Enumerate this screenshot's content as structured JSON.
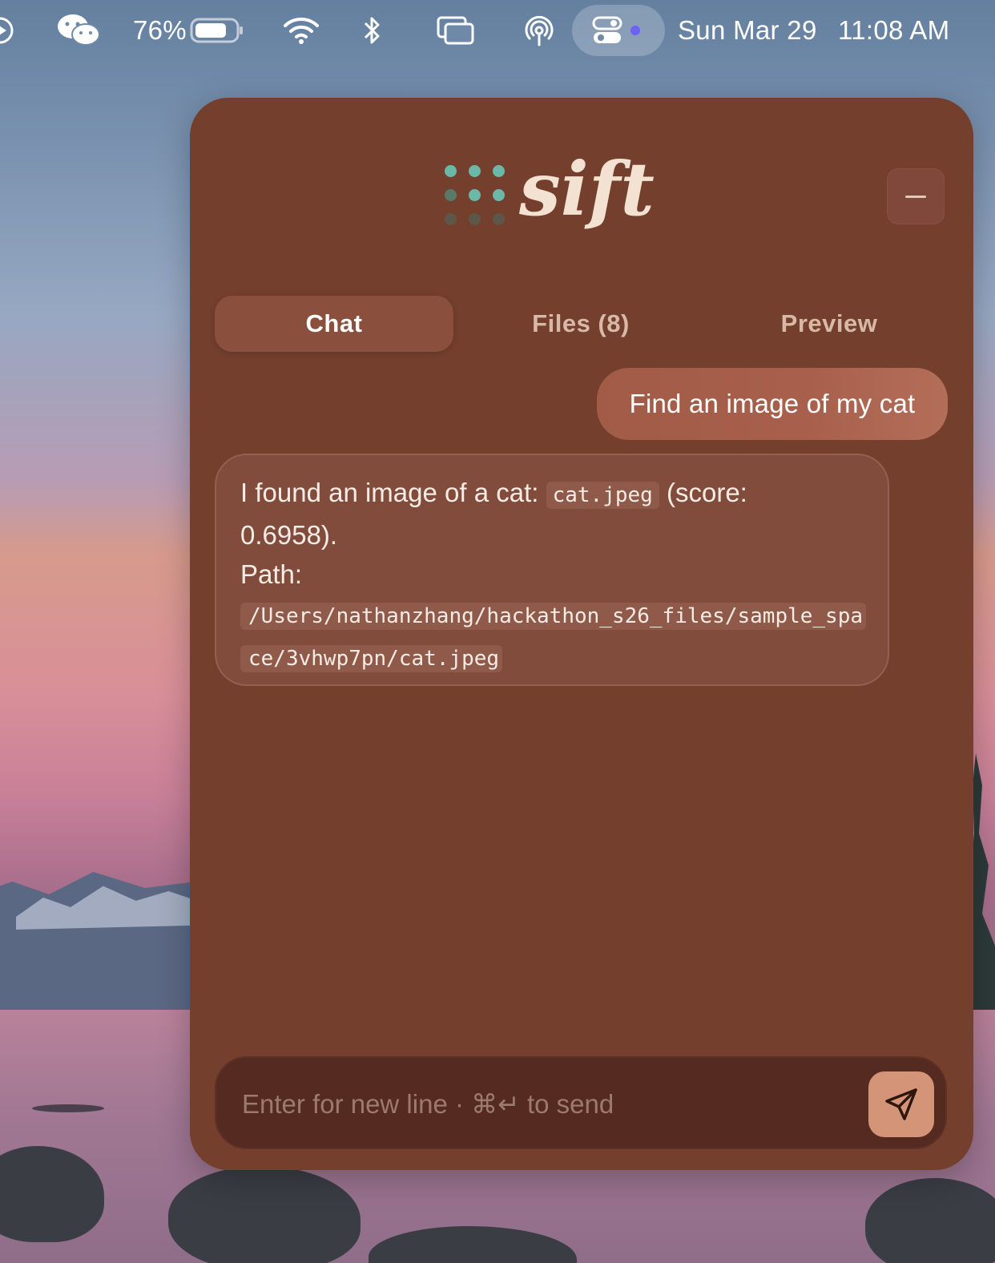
{
  "menubar": {
    "battery_percent": "76%",
    "date": "Sun Mar 29",
    "time": "11:08 AM",
    "icons": [
      "play-circle-icon",
      "wechat-icon",
      "battery-icon",
      "wifi-icon",
      "bluetooth-icon",
      "screen-mirroring-icon",
      "airdrop-icon",
      "control-center-icon"
    ]
  },
  "app": {
    "logo_text": "sift",
    "logo_dot_colors": [
      "#6cb8a8",
      "#6cb8a8",
      "#6cb8a8",
      "#5a7a68",
      "#6cb8a8",
      "#6cb8a8",
      "#5d574a",
      "#5d574a",
      "#5d574a"
    ],
    "tabs": [
      {
        "label": "Chat",
        "active": true
      },
      {
        "label": "Files (8)",
        "active": false
      },
      {
        "label": "Preview",
        "active": false
      }
    ],
    "user_message": "Find an image of my cat",
    "bot_message": {
      "intro": "I found an image of a cat:",
      "filename": "cat.jpeg",
      "score_open": "(score:",
      "score_value": "0.6958).",
      "path_label": "Path:",
      "path": "/Users/nathanzhang/hackathon_s26_files/sample_space/3vhwp7pn/cat.jpeg"
    },
    "composer": {
      "placeholder": "Enter for new line · ⌘↵ to send",
      "value": ""
    }
  },
  "colors": {
    "window_bg": "#743f2d",
    "accent": "#d49478",
    "user_bubble": "#a8604c",
    "bot_bubble": "#824c3c"
  }
}
